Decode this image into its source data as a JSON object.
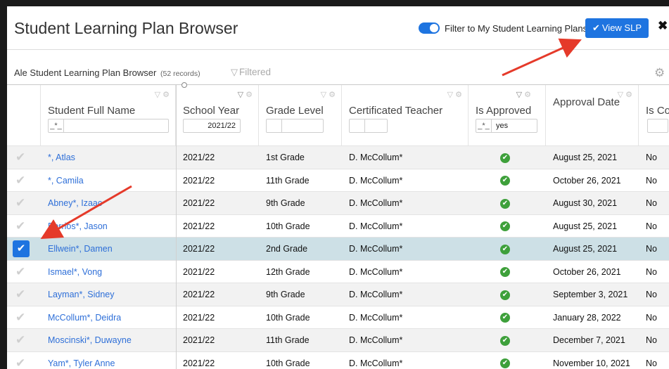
{
  "header": {
    "title": "Student Learning Plan Browser",
    "filter_toggle_label": "Filter to My Student Learning Plans",
    "view_button_label": "View SLP",
    "close_glyph": "✖"
  },
  "subbar": {
    "title": "Ale Student Learning Plan Browser",
    "records": "(52 records)",
    "filtered_label": "Filtered"
  },
  "columns": [
    {
      "label": "Student Full Name",
      "filter_op": "_*_",
      "filter_value": ""
    },
    {
      "label": "School Year",
      "filter_op": "",
      "filter_value": "2021/22"
    },
    {
      "label": "Grade Level",
      "filter_op": "",
      "filter_value": ""
    },
    {
      "label": "Certificated Teacher",
      "filter_op": "",
      "filter_value": ""
    },
    {
      "label": "Is Approved",
      "filter_op": "_*_",
      "filter_value": "yes"
    },
    {
      "label": "Approval Date"
    },
    {
      "label": "Is Co"
    }
  ],
  "rows": [
    {
      "name": "*, Atlas",
      "year": "2021/22",
      "grade": "1st Grade",
      "teacher": "D. McCollum*",
      "date": "August 25, 2021",
      "isco": "No",
      "selected": false
    },
    {
      "name": "*, Camila",
      "year": "2021/22",
      "grade": "11th Grade",
      "teacher": "D. McCollum*",
      "date": "October 26, 2021",
      "isco": "No",
      "selected": false
    },
    {
      "name": "Abney*, Izaac",
      "year": "2021/22",
      "grade": "9th Grade",
      "teacher": "D. McCollum*",
      "date": "August 30, 2021",
      "isco": "No",
      "selected": false
    },
    {
      "name": "Berrios*, Jason",
      "year": "2021/22",
      "grade": "10th Grade",
      "teacher": "D. McCollum*",
      "date": "August 25, 2021",
      "isco": "No",
      "selected": false
    },
    {
      "name": "Ellwein*, Damen",
      "year": "2021/22",
      "grade": "2nd Grade",
      "teacher": "D. McCollum*",
      "date": "August 25, 2021",
      "isco": "No",
      "selected": true
    },
    {
      "name": "Ismael*, Vong",
      "year": "2021/22",
      "grade": "12th Grade",
      "teacher": "D. McCollum*",
      "date": "October 26, 2021",
      "isco": "No",
      "selected": false
    },
    {
      "name": "Layman*, Sidney",
      "year": "2021/22",
      "grade": "9th Grade",
      "teacher": "D. McCollum*",
      "date": "September 3, 2021",
      "isco": "No",
      "selected": false
    },
    {
      "name": "McCollum*, Deidra",
      "year": "2021/22",
      "grade": "10th Grade",
      "teacher": "D. McCollum*",
      "date": "January 28, 2022",
      "isco": "No",
      "selected": false
    },
    {
      "name": "Moscinski*, Duwayne",
      "year": "2021/22",
      "grade": "11th Grade",
      "teacher": "D. McCollum*",
      "date": "December 7, 2021",
      "isco": "No",
      "selected": false
    },
    {
      "name": "Yam*, Tyler Anne",
      "year": "2021/22",
      "grade": "10th Grade",
      "teacher": "D. McCollum*",
      "date": "November 10, 2021",
      "isco": "No",
      "selected": false
    }
  ],
  "colors": {
    "accent": "#1e74e0",
    "approved": "#3ea03b",
    "selected_row": "#cde0e6",
    "annotation_arrow": "#e53a2a"
  },
  "icons": {
    "check": "checkmark-icon",
    "approved": "approved-check-icon",
    "filter": "filter-icon",
    "gear": "gear-icon"
  }
}
